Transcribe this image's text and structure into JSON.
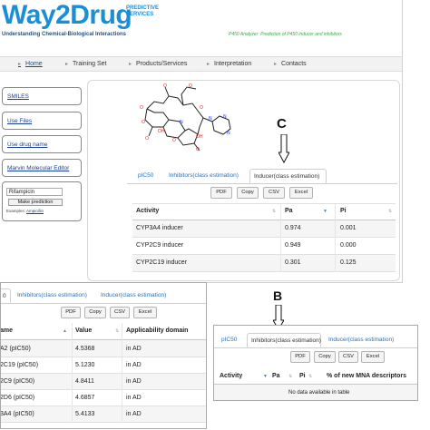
{
  "header": {
    "logo_text": "Way2Drug",
    "logo_side": [
      "PREDICTIVE",
      "SERVICES"
    ],
    "logo_sub": "Understanding Chemical-Biological Interactions",
    "subtitle": "P450 Analyzer: Prediction of P450 inducer and inhibitors"
  },
  "nav": {
    "items": [
      {
        "label": "Home"
      },
      {
        "label": "Training Set"
      },
      {
        "label": "Products/Services"
      },
      {
        "label": "Interpretation"
      },
      {
        "label": "Contacts"
      }
    ]
  },
  "sidebar": {
    "smiles": "SMILES",
    "use_files": "Use Files",
    "use_drug_name": "Use drug name",
    "marvin": "Marvin Molecular Editor",
    "drug_input_value": "Rifampicin",
    "make_prediction": "Make prediction",
    "examples_label": "Examples:",
    "examples_link": "Ampicillin"
  },
  "annotations": {
    "label_c": "C",
    "label_b": "B"
  },
  "main_panel": {
    "tabs": [
      "pIC50",
      "Inhibitors(class estimation)",
      "Inducer(class estimation)"
    ],
    "buttons": [
      "PDF",
      "Copy",
      "CSV",
      "Excel"
    ],
    "columns": [
      "Activity",
      "Pa",
      "Pi"
    ],
    "rows": [
      [
        "CYP3A4 inducer",
        "0.974",
        "0.001"
      ],
      [
        "CYP2C9 inducer",
        "0.949",
        "0.000"
      ],
      [
        "CYP2C19 inducer",
        "0.301",
        "0.125"
      ]
    ]
  },
  "inset_a": {
    "tabs": [
      "0",
      "Inhibitors(class estimation)",
      "Inducer(class estimation)"
    ],
    "buttons": [
      "PDF",
      "Copy",
      "CSV",
      "Excel"
    ],
    "columns": [
      "ame",
      "Value",
      "Applicability domain"
    ],
    "rows": [
      [
        "A2 (pIC50)",
        "4.5368",
        "in AD"
      ],
      [
        "2C19 (pIC50)",
        "5.1230",
        "in AD"
      ],
      [
        "2C9 (pIC50)",
        "4.8411",
        "in AD"
      ],
      [
        "2D6 (pIC50)",
        "4.6857",
        "in AD"
      ],
      [
        "3A4 (pIC50)",
        "5.4133",
        "in AD"
      ]
    ]
  },
  "inset_b": {
    "tabs": [
      "pIC50",
      "Inhibitors(class estimation)",
      "Inducer(class estimation)"
    ],
    "buttons": [
      "PDF",
      "Copy",
      "CSV",
      "Excel"
    ],
    "columns": [
      "Activity",
      "Pa",
      "Pi",
      "% of new MNA descriptors"
    ],
    "empty_message": "No data available in table"
  },
  "colors": {
    "brand_blue": "#1b8fd6",
    "subtitle_green": "#3aa84a",
    "link_blue": "#1a3f8f",
    "tab_blue": "#2d6fb3"
  }
}
